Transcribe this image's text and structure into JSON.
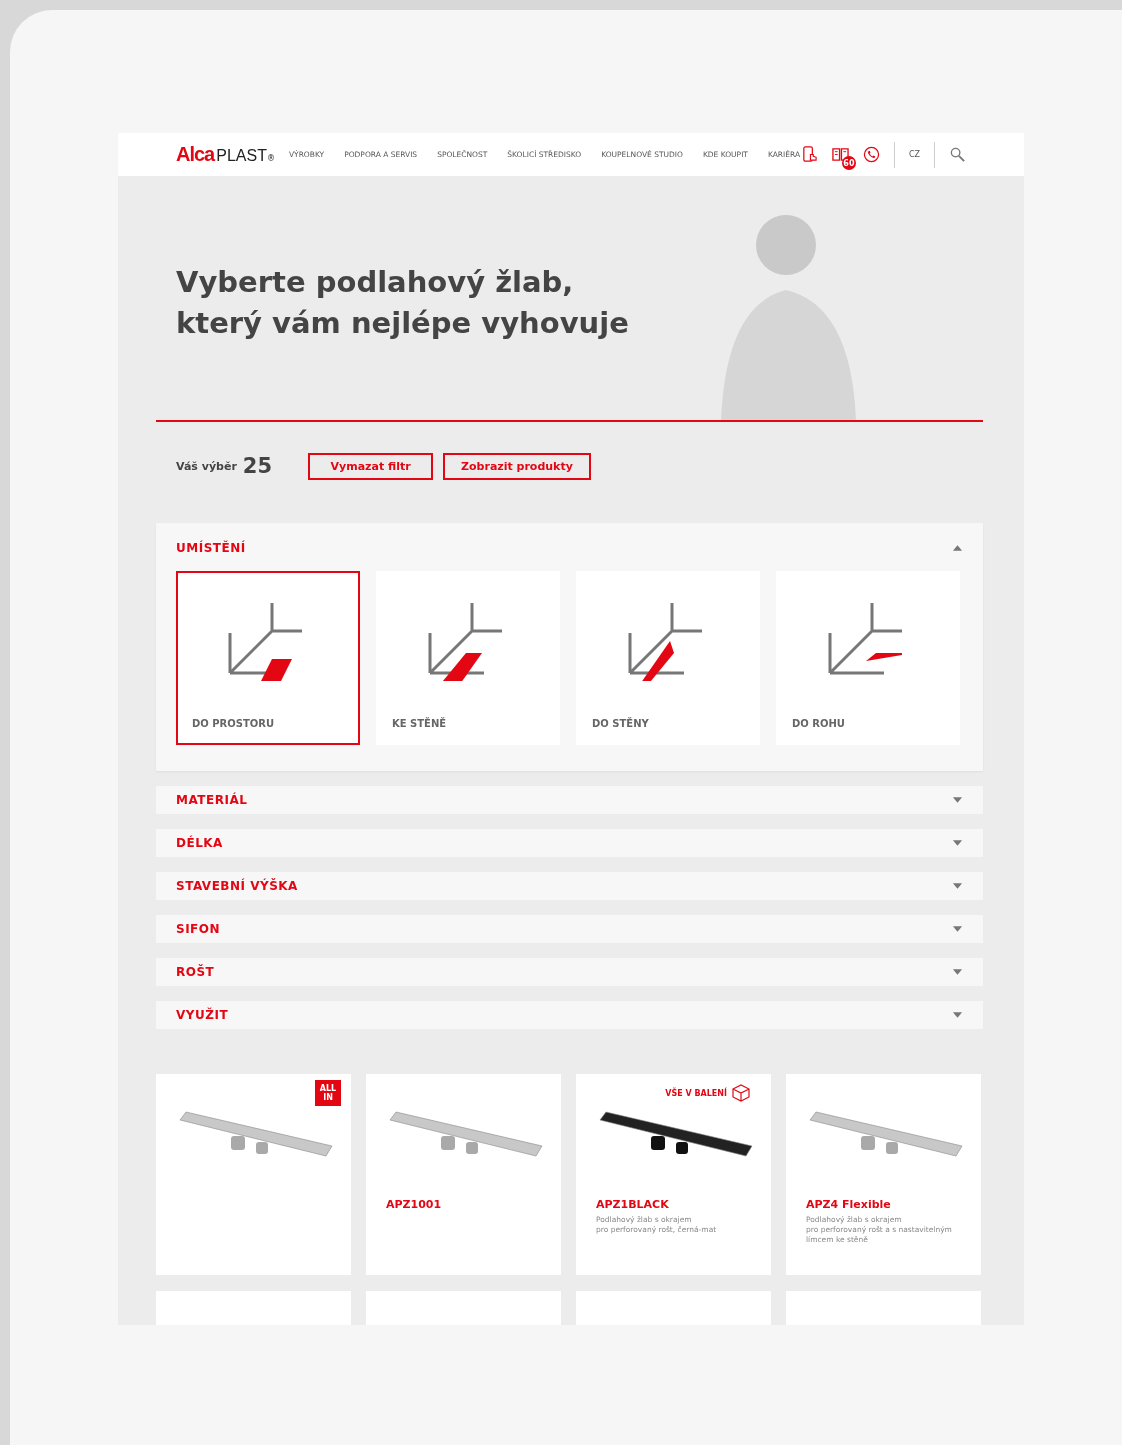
{
  "header": {
    "logo": {
      "brand": "Alca",
      "suffix": "PLAST",
      "mark": "®"
    },
    "nav": [
      "VÝROBKY",
      "PODPORA A SERVIS",
      "SPOLEČNOST",
      "ŠKOLICÍ STŘEDISKO",
      "KOUPELNOVÉ STUDIO",
      "KDE KOUPIT",
      "KARIÉRA"
    ],
    "catalog_badge": "60",
    "language": "CZ"
  },
  "hero": {
    "title_lines": [
      "Vyberte podlahový žlab,",
      "který vám nejlépe vyhovuje"
    ]
  },
  "selection": {
    "label": "Váš výběr",
    "count": "25",
    "buttons": [
      "Vymazat filtr",
      "Zobrazit produkty"
    ]
  },
  "filters": [
    {
      "title": "UMÍSTĚNÍ",
      "expanded": true,
      "options": [
        {
          "label": "DO PROSTORU",
          "kind": "floor",
          "selected": true
        },
        {
          "label": "KE STĚNĚ",
          "kind": "near_wall",
          "selected": false
        },
        {
          "label": "DO STĚNY",
          "kind": "into_wall",
          "selected": false
        },
        {
          "label": "DO ROHU",
          "kind": "corner",
          "selected": false
        }
      ]
    },
    {
      "title": "MATERIÁL",
      "expanded": false
    },
    {
      "title": "DÉLKA",
      "expanded": false
    },
    {
      "title": "STAVEBNÍ VÝŠKA",
      "expanded": false
    },
    {
      "title": "SIFON",
      "expanded": false
    },
    {
      "title": "ROŠT",
      "expanded": false
    },
    {
      "title": "VYUŽIT",
      "expanded": false
    }
  ],
  "products": [
    {
      "kind": "steel",
      "badge": {
        "kind": "all_in",
        "text": "ALL IN"
      }
    },
    {
      "kind": "steel",
      "name": "APZ1001"
    },
    {
      "kind": "black",
      "badge": {
        "kind": "package",
        "text": "VŠE V BALENÍ"
      },
      "name": "APZ1BLACK",
      "description": [
        "Podlahový žlab s okrajem",
        "pro perforovaný rošt, černá-mat"
      ]
    },
    {
      "kind": "steel",
      "name": "APZ4 Flexible",
      "description": [
        "Podlahový žlab s okrajem",
        "pro perforovaný rošt a s nastavitelným",
        "límcem ke stěně"
      ]
    }
  ]
}
